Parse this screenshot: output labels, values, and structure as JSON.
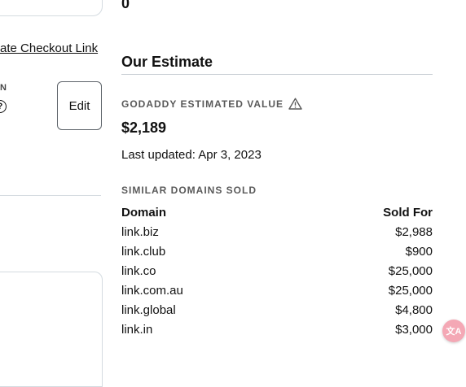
{
  "left": {
    "checkout_link": "ate Checkout Link",
    "n_label": "N",
    "help_icon_glyph": "?",
    "edit_label": "Edit"
  },
  "right": {
    "count": "0",
    "section_title": "Our Estimate",
    "estimated_label": "GODADDY ESTIMATED VALUE",
    "estimated_value": "$2,189",
    "last_updated": "Last updated: Apr 3, 2023",
    "similar_label": "SIMILAR DOMAINS SOLD",
    "table": {
      "headers": [
        "Domain",
        "Sold For"
      ],
      "rows": [
        [
          "link.biz",
          "$2,988"
        ],
        [
          "link.club",
          "$900"
        ],
        [
          "link.co",
          "$25,000"
        ],
        [
          "link.com.au",
          "$25,000"
        ],
        [
          "link.global",
          "$4,800"
        ],
        [
          "link.in",
          "$3,000"
        ]
      ]
    }
  },
  "icons": {
    "warning": "warning-triangle-icon",
    "help": "help-circle-icon",
    "translate": "translate-icon"
  },
  "colors": {
    "accent_fab": "#f4a8b5",
    "muted_label": "#595959",
    "border": "#d4dbe0"
  },
  "translate_glyph": "文A"
}
